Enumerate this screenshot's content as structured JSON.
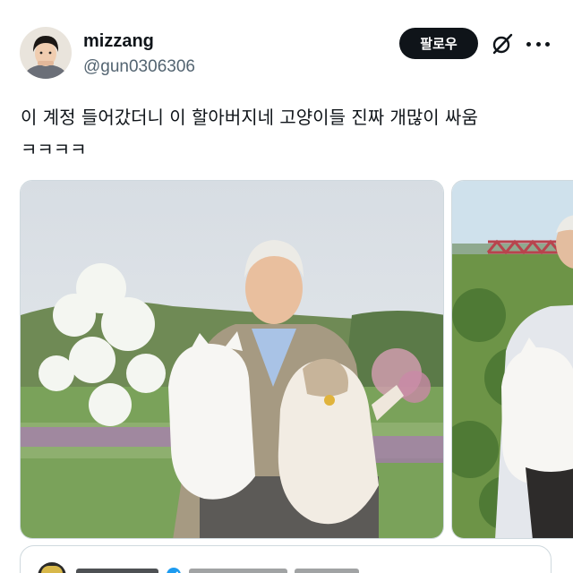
{
  "author": {
    "display_name": "mizzang",
    "handle": "@gun0306306"
  },
  "actions": {
    "follow_label": "팔로우",
    "grok_icon": "grok-icon",
    "more_icon": "more-icon"
  },
  "tweet": {
    "text": "이 계정 들어갔더니 이 할아버지네 고양이들 진짜 개많이 싸움\nㅋㅋㅋㅋ"
  },
  "media": {
    "count": 2
  },
  "colors": {
    "follow_bg": "#0f1419",
    "handle_gray": "#536471",
    "border": "#cfd9de",
    "verified_blue": "#1d9bf0"
  }
}
